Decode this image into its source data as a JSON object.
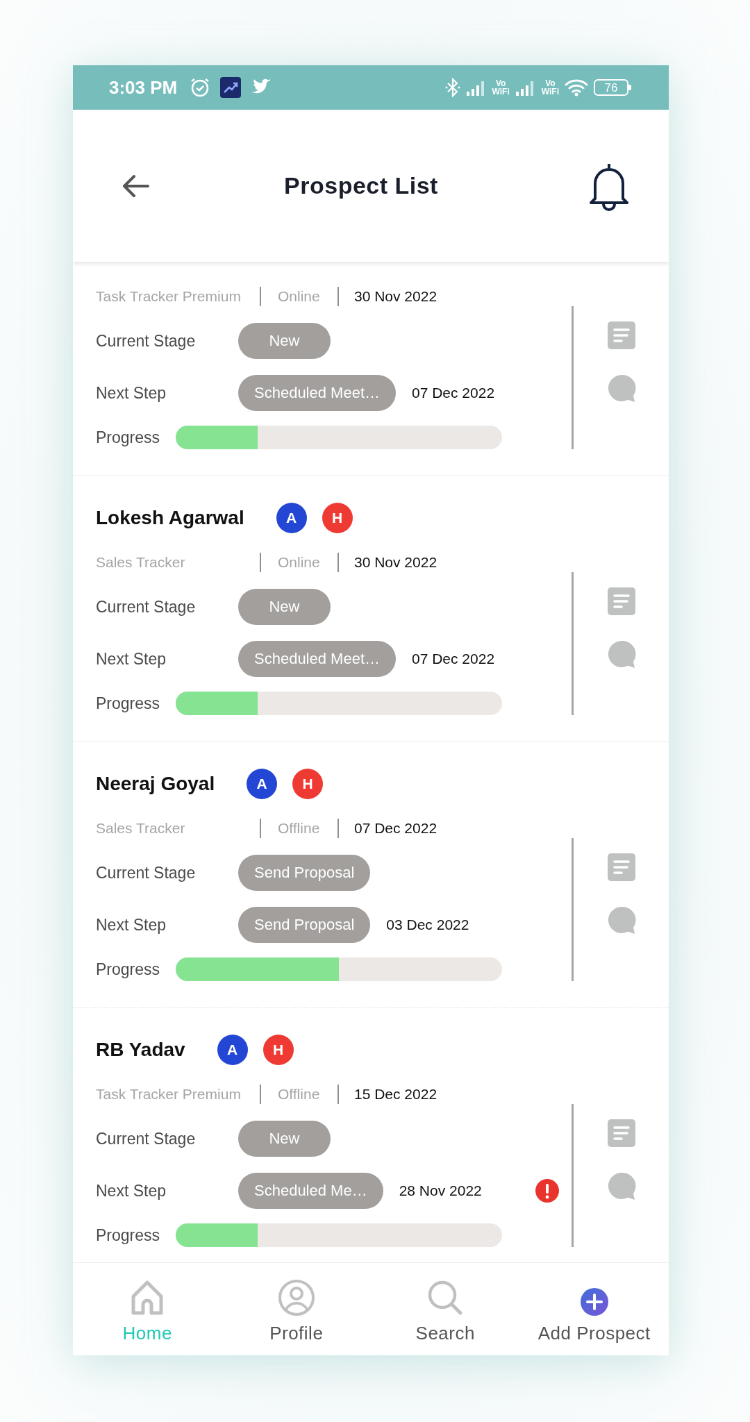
{
  "status_bar": {
    "time": "3:03 PM",
    "network_labels": [
      {
        "top": "Vo",
        "bottom": "WiFi"
      },
      {
        "top": "Vo",
        "bottom": "WiFi"
      }
    ],
    "battery": "76"
  },
  "header": {
    "title": "Prospect List"
  },
  "prospects": [
    {
      "product": "Task Tracker Premium",
      "mode": "Online",
      "date": "30 Nov 2022",
      "stage_label": "Current Stage",
      "stage": "New",
      "next_label": "Next Step",
      "next_step": "Scheduled Meet…",
      "next_date": "07 Dec 2022",
      "progress_label": "Progress",
      "level": 0.25,
      "alert": false
    },
    {
      "name": "Lokesh Agarwal",
      "badges": [
        {
          "letter": "A",
          "color": "#2347d4"
        },
        {
          "letter": "H",
          "color": "#ee3a32"
        }
      ],
      "product": "Sales Tracker",
      "mode": "Online",
      "date": "30 Nov 2022",
      "stage_label": "Current Stage",
      "stage": "New",
      "next_label": "Next Step",
      "next_step": "Scheduled Meet…",
      "next_date": "07 Dec 2022",
      "progress_label": "Progress",
      "level": 0.25,
      "alert": false
    },
    {
      "name": "Neeraj Goyal",
      "badges": [
        {
          "letter": "A",
          "color": "#2347d4"
        },
        {
          "letter": "H",
          "color": "#ee3a32"
        }
      ],
      "product": "Sales Tracker",
      "mode": "Offline",
      "date": "07 Dec 2022",
      "stage_label": "Current Stage",
      "stage": "Send Proposal",
      "next_label": "Next Step",
      "next_step": "Send Proposal",
      "next_date": "03 Dec 2022",
      "progress_label": "Progress",
      "level": 0.5,
      "alert": false
    },
    {
      "name": "RB Yadav",
      "badges": [
        {
          "letter": "A",
          "color": "#2347d4"
        },
        {
          "letter": "H",
          "color": "#ee3a32"
        }
      ],
      "product": "Task Tracker Premium",
      "mode": "Offline",
      "date": "15 Dec 2022",
      "stage_label": "Current Stage",
      "stage": "New",
      "next_label": "Next Step",
      "next_step": "Scheduled Me…",
      "next_date": "28 Nov 2022",
      "progress_label": "Progress",
      "level": 0.25,
      "alert": true
    }
  ],
  "nav": [
    {
      "kind": "home",
      "label": "Home",
      "selected": true
    },
    {
      "kind": "profile",
      "label": "Profile",
      "selected": false
    },
    {
      "kind": "search",
      "label": "Search",
      "selected": false
    },
    {
      "kind": "add",
      "label": "Add Prospect",
      "selected": false
    }
  ]
}
